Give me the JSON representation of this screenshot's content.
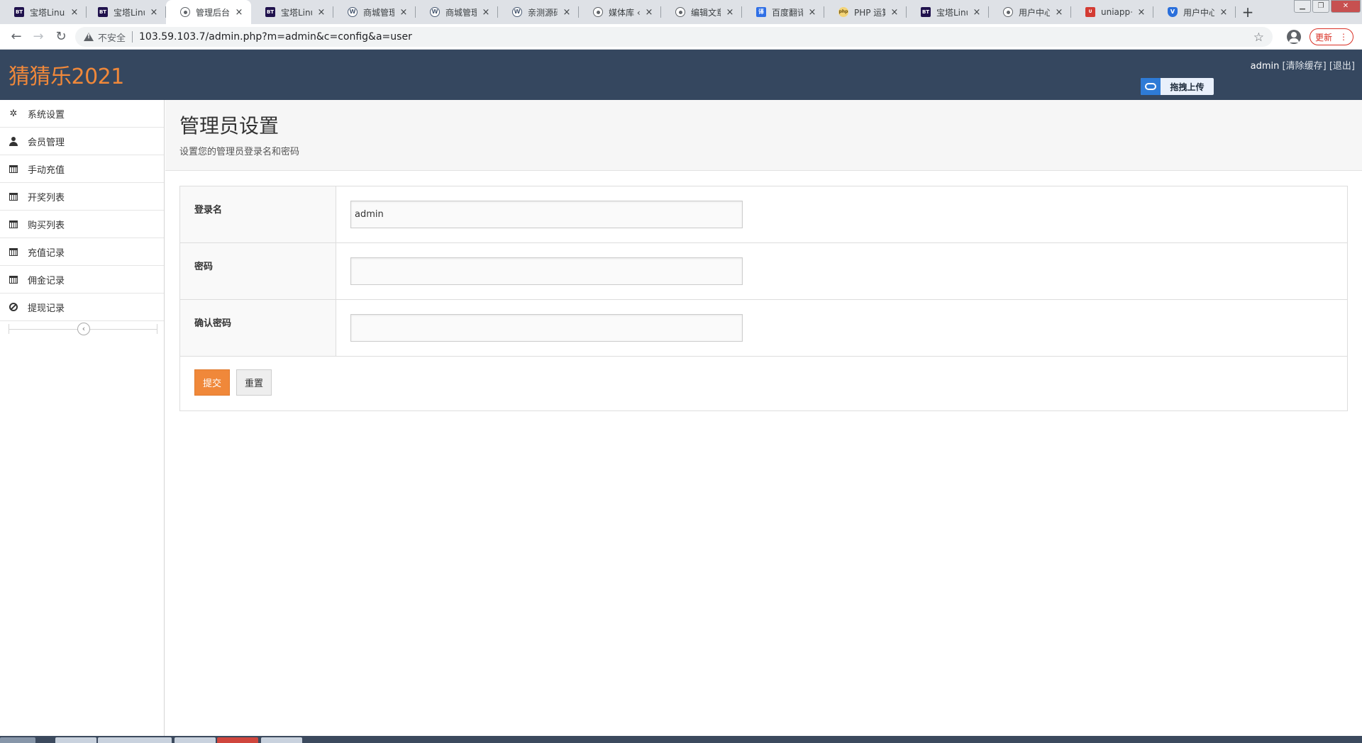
{
  "browser": {
    "tabs": [
      {
        "title": "宝塔Linux",
        "favicon": "bt",
        "active": false
      },
      {
        "title": "宝塔Linux",
        "favicon": "bt",
        "active": false
      },
      {
        "title": "管理后台",
        "favicon": "globe",
        "active": true
      },
      {
        "title": "宝塔Linux",
        "favicon": "bt",
        "active": false
      },
      {
        "title": "商城管理",
        "favicon": "wp",
        "active": false
      },
      {
        "title": "商城管理",
        "favicon": "wp",
        "active": false
      },
      {
        "title": "亲测源码",
        "favicon": "wp",
        "active": false
      },
      {
        "title": "媒体库 ‹",
        "favicon": "globe",
        "active": false
      },
      {
        "title": "编辑文章",
        "favicon": "globe",
        "active": false
      },
      {
        "title": "百度翻译",
        "favicon": "baidu",
        "active": false
      },
      {
        "title": "PHP 运算",
        "favicon": "php",
        "active": false
      },
      {
        "title": "宝塔Linux",
        "favicon": "bt",
        "active": false
      },
      {
        "title": "用户中心",
        "favicon": "globe",
        "active": false
      },
      {
        "title": "uniapp+",
        "favicon": "uni",
        "active": false
      },
      {
        "title": "用户中心",
        "favicon": "shield",
        "active": false
      }
    ],
    "favicon_text": {
      "bt": "BT",
      "wp": "W",
      "globe": "",
      "baidu": "译",
      "php": "php",
      "uni": "U",
      "shield": "V"
    },
    "new_tab": "+",
    "security_label": "不安全",
    "url": "103.59.103.7/admin.php?m=admin&c=config&a=user",
    "update_label": "更新",
    "update_menu": "⋮"
  },
  "header": {
    "logo": "猜猜乐2021",
    "user": "admin",
    "clear_cache": "[清除缓存]",
    "logout": "[退出]",
    "upload_label": "拖拽上传"
  },
  "sidebar": {
    "items": [
      {
        "label": "系统设置",
        "icon": "gear-icon"
      },
      {
        "label": "会员管理",
        "icon": "user-icon"
      },
      {
        "label": "手动充值",
        "icon": "calendar-icon"
      },
      {
        "label": "开奖列表",
        "icon": "calendar-icon"
      },
      {
        "label": "购买列表",
        "icon": "calendar-icon"
      },
      {
        "label": "充值记录",
        "icon": "calendar-icon"
      },
      {
        "label": "佣金记录",
        "icon": "calendar-icon"
      },
      {
        "label": "提现记录",
        "icon": "ban-icon"
      }
    ],
    "collapse": "‹"
  },
  "page": {
    "title": "管理员设置",
    "description": "设置您的管理员登录名和密码"
  },
  "form": {
    "fields": [
      {
        "label": "登录名",
        "value": "admin",
        "type": "text"
      },
      {
        "label": "密码",
        "value": "",
        "type": "password"
      },
      {
        "label": "确认密码",
        "value": "",
        "type": "password"
      }
    ],
    "submit_label": "提交",
    "reset_label": "重置"
  },
  "colors": {
    "header_bg": "#35475f",
    "accent": "#f0883a"
  }
}
